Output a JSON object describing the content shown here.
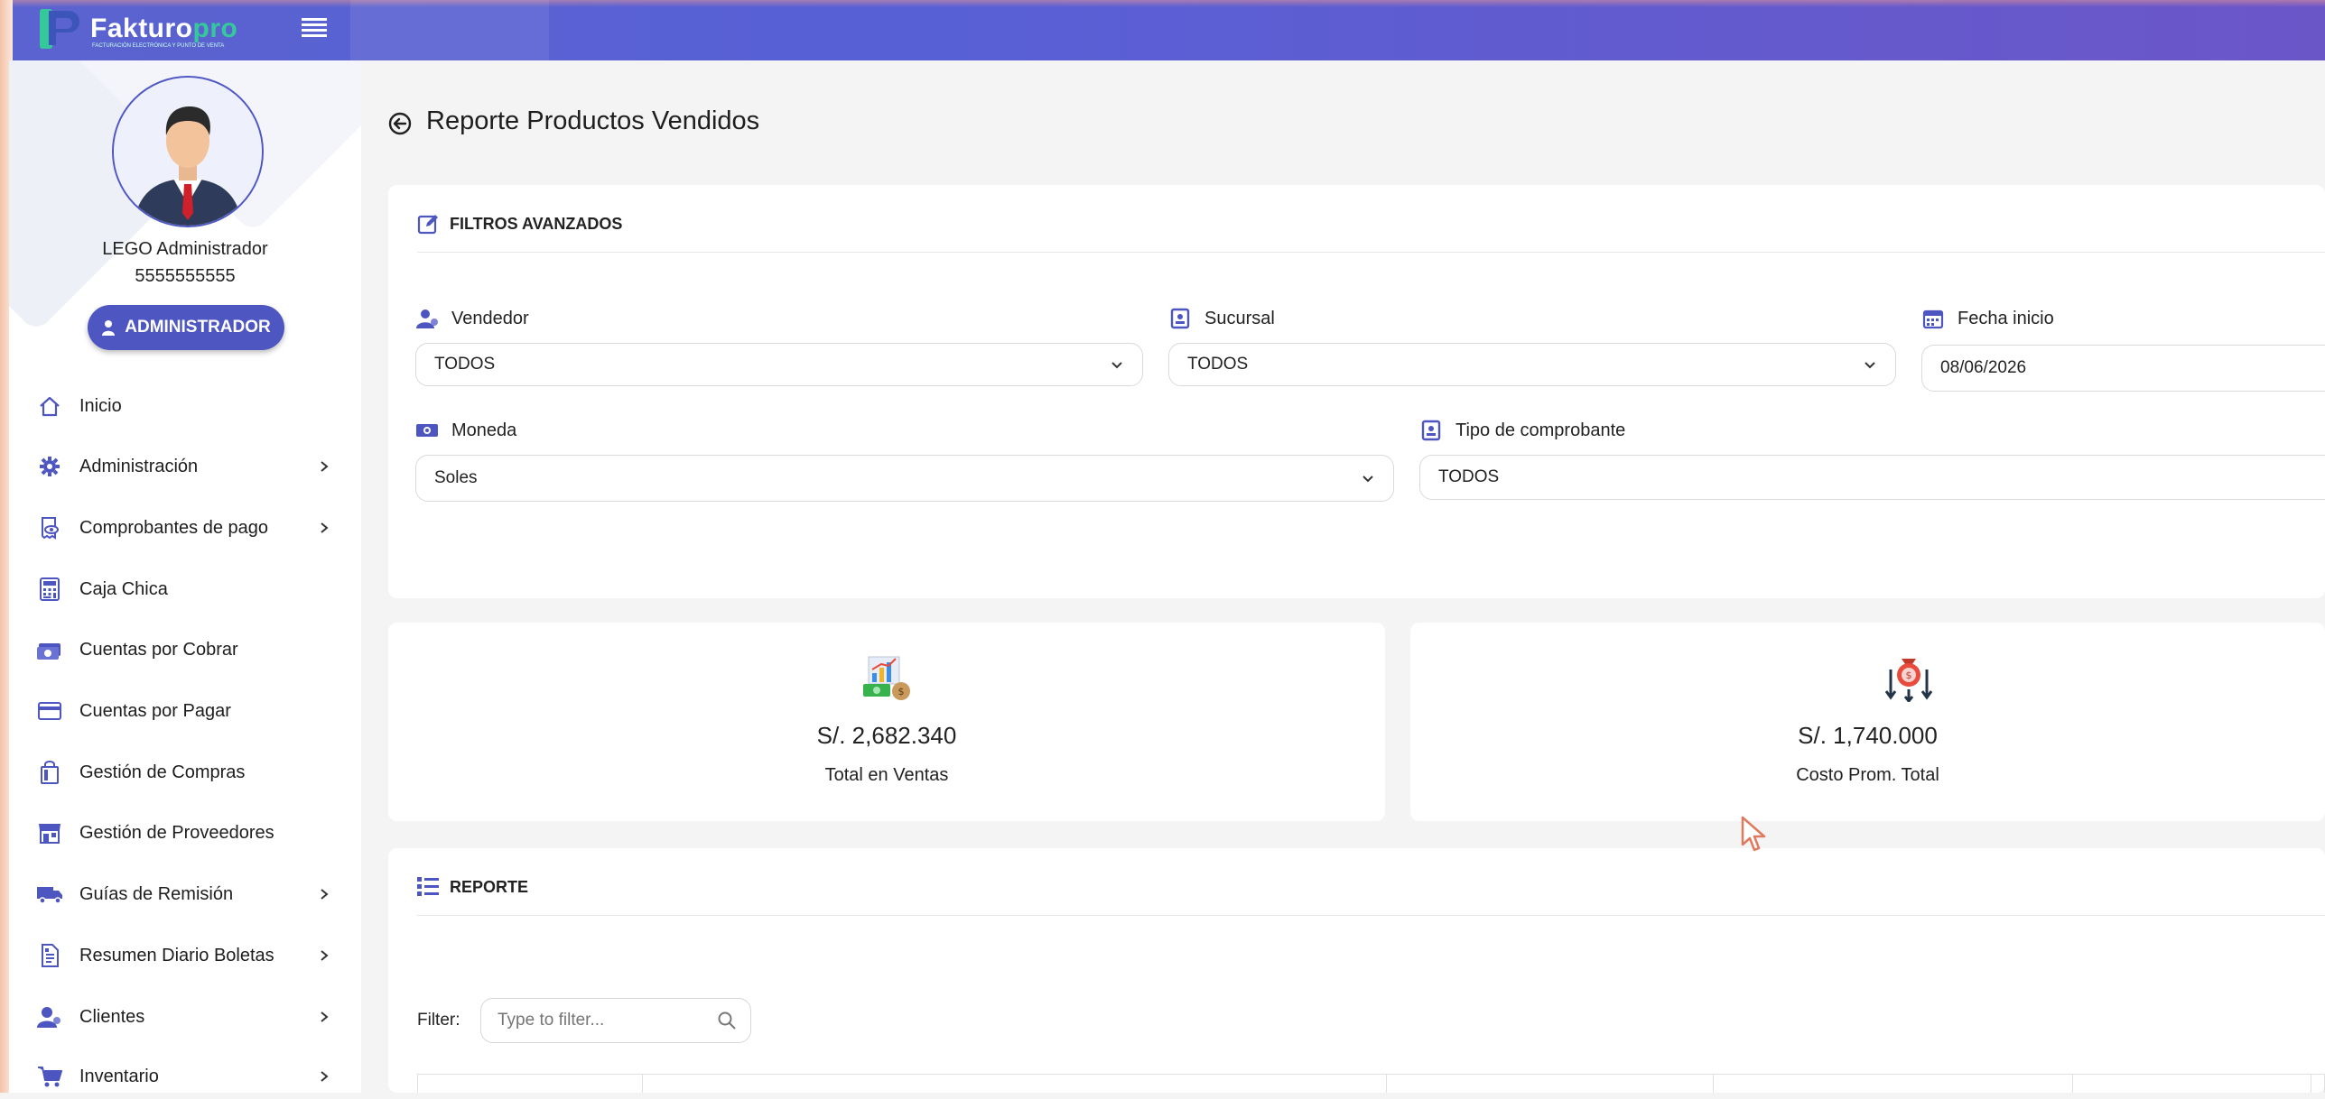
{
  "app": {
    "logo_text": "Fakturo",
    "logo_text_suffix": "pro",
    "logo_tagline": "FACTURACIÓN ELECTRÓNICA Y PUNTO DE VENTA"
  },
  "user": {
    "name": "LEGO Administrador",
    "phone": "5555555555",
    "role_label": "ADMINISTRADOR"
  },
  "sidebar": {
    "items": [
      {
        "label": "Inicio",
        "icon": "home-icon",
        "has_submenu": false
      },
      {
        "label": "Administración",
        "icon": "gear-icon",
        "has_submenu": true
      },
      {
        "label": "Comprobantes de pago",
        "icon": "receipt-eye-icon",
        "has_submenu": true
      },
      {
        "label": "Caja Chica",
        "icon": "calculator-icon",
        "has_submenu": false
      },
      {
        "label": "Cuentas por Cobrar",
        "icon": "money-icon",
        "has_submenu": false
      },
      {
        "label": "Cuentas por Pagar",
        "icon": "credit-card-icon",
        "has_submenu": false
      },
      {
        "label": "Gestión de Compras",
        "icon": "shopping-bag-icon",
        "has_submenu": false
      },
      {
        "label": "Gestión de Proveedores",
        "icon": "store-icon",
        "has_submenu": false
      },
      {
        "label": "Guías de Remisión",
        "icon": "truck-icon",
        "has_submenu": true
      },
      {
        "label": "Resumen Diario Boletas",
        "icon": "document-icon",
        "has_submenu": true
      },
      {
        "label": "Clientes",
        "icon": "users-icon",
        "has_submenu": true
      },
      {
        "label": "Inventario",
        "icon": "cart-icon",
        "has_submenu": true
      }
    ]
  },
  "page": {
    "title": "Reporte Productos Vendidos"
  },
  "filters": {
    "section_title": "FILTROS AVANZADOS",
    "vendedor": {
      "label": "Vendedor",
      "value": "TODOS"
    },
    "sucursal": {
      "label": "Sucursal",
      "value": "TODOS"
    },
    "fecha_inicio": {
      "label": "Fecha inicio",
      "value": "08/06/2026"
    },
    "moneda": {
      "label": "Moneda",
      "value": "Soles"
    },
    "tipo_comprobante": {
      "label": "Tipo de comprobante",
      "value": "TODOS"
    }
  },
  "stats": {
    "total_ventas": {
      "value": "S/. 2,682.340",
      "label": "Total en Ventas"
    },
    "costo_prom": {
      "value": "S/. 1,740.000",
      "label": "Costo Prom. Total"
    }
  },
  "report": {
    "section_title": "REPORTE",
    "filter_label": "Filter:",
    "filter_placeholder": "Type to filter..."
  },
  "colors": {
    "brand": "#4e56c2",
    "brand_accent": "#34c89a",
    "topbar": "#5a63cf"
  }
}
